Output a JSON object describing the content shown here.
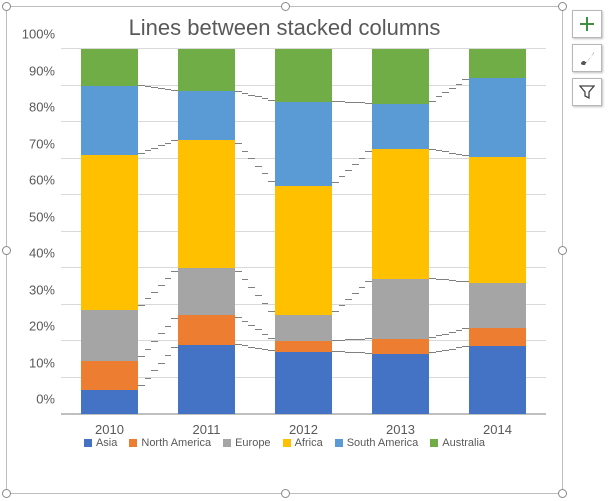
{
  "chart_data": {
    "type": "bar",
    "stacked": true,
    "percent": true,
    "title": "Lines between stacked columns",
    "xlabel": "",
    "ylabel": "",
    "ylim": [
      0,
      100
    ],
    "ytick_step": 10,
    "ygrid": true,
    "legend_position": "bottom",
    "categories": [
      "2010",
      "2011",
      "2012",
      "2013",
      "2014"
    ],
    "series": [
      {
        "name": "Asia",
        "color": "#4472C4",
        "values": [
          6.5,
          19,
          17,
          16.5,
          18.5
        ]
      },
      {
        "name": "North America",
        "color": "#ED7D31",
        "values": [
          8,
          8,
          3,
          4,
          5
        ]
      },
      {
        "name": "Europe",
        "color": "#A5A5A5",
        "values": [
          14,
          13,
          7,
          16.5,
          12.5
        ]
      },
      {
        "name": "Africa",
        "color": "#FFC000",
        "values": [
          42.5,
          35,
          35.5,
          35.5,
          34.5
        ]
      },
      {
        "name": "South America",
        "color": "#5B9BD5",
        "values": [
          19,
          13.5,
          23,
          12.5,
          21.5
        ]
      },
      {
        "name": "Australia",
        "color": "#70AD47",
        "values": [
          10,
          11.5,
          14.5,
          15,
          8
        ]
      }
    ],
    "yticks": [
      "0%",
      "10%",
      "20%",
      "30%",
      "40%",
      "50%",
      "60%",
      "70%",
      "80%",
      "90%",
      "100%"
    ]
  },
  "side_buttons": {
    "add_element": "Chart Elements",
    "style": "Chart Styles",
    "filter": "Chart Filters"
  }
}
